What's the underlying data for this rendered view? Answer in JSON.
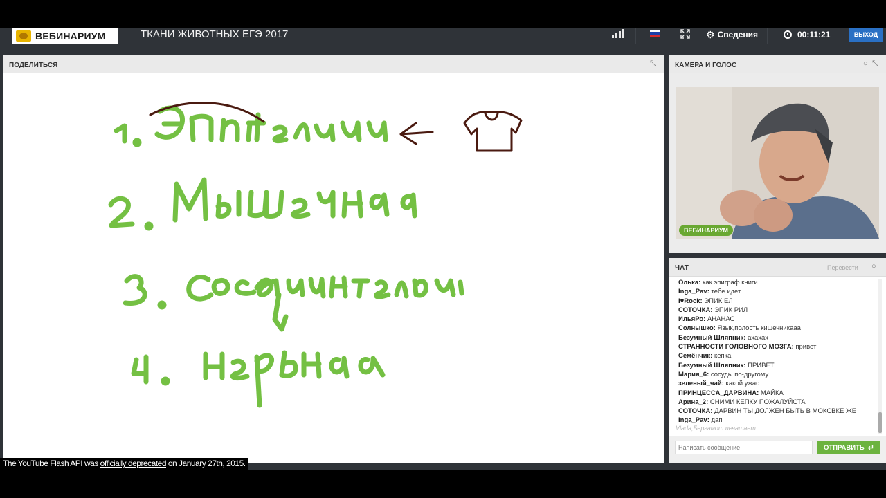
{
  "topbar": {
    "logo_text": "ВЕБИНАРИУМ",
    "course_title": "ТКАНИ ЖИВОТНЫХ  ЕГЭ 2017",
    "info_label": "Сведения",
    "timer": "00:11:21",
    "exit_label": "ВЫХОД",
    "flag_colors": [
      "#ffffff",
      "#1c3fa8",
      "#d62b2b"
    ]
  },
  "share_panel": {
    "title": "ПОДЕЛИТЬСЯ",
    "whiteboard": {
      "ink_green": "#74c043",
      "ink_brown": "#4a1a10"
    }
  },
  "camera_panel": {
    "title": "КАМЕРА И ГОЛОС",
    "badge": "ВЕБИНАРИУМ"
  },
  "chat": {
    "title": "ЧАТ",
    "translate_label": "Перевести",
    "messages": [
      {
        "user": "Олька:",
        "text": " как эпиграф книги"
      },
      {
        "user": "Inga_Pav:",
        "text": " тебе идет"
      },
      {
        "user": "I♥Rock:",
        "text": " ЭПИК ЕЛ"
      },
      {
        "user": "СОТОЧКА:",
        "text": " ЭПИК РИЛ"
      },
      {
        "user": "ИльяРо:",
        "text": " АНАНАС"
      },
      {
        "user": "Солнышко:",
        "text": " Язык,полость кишечникааа"
      },
      {
        "user": "Безумный Шляпник:",
        "text": " ахахах"
      },
      {
        "user": "СТРАННОСТИ ГОЛОВНОГО МОЗГА:",
        "text": " привет"
      },
      {
        "user": "Семёнчик:",
        "text": " кепка"
      },
      {
        "user": "Безумный Шляпник:",
        "text": " ПРИВЕТ"
      },
      {
        "user": "Мария_6:",
        "text": " сосуды по-другому"
      },
      {
        "user": "зеленый_чай:",
        "text": " какой ужас"
      },
      {
        "user": "ПРИНЦЕССА_ДАРВИНА:",
        "text": " МАЙКА"
      },
      {
        "user": "Арина_2:",
        "text": " СНИМИ КЕПКУ ПОЖАЛУЙСТА"
      },
      {
        "user": "СОТОЧКА:",
        "text": " ДАРВИН ТЫ ДОЛЖЕН БЫТЬ В МОКСВКЕ ЖЕ"
      },
      {
        "user": "Inga_Pav:",
        "text": " дап"
      }
    ],
    "typing": "Vlada,Бергамот печатает...",
    "input_placeholder": "Написать сообщение",
    "send_label": "ОТПРАВИТЬ"
  },
  "deprecation": {
    "prefix": "The YouTube Flash API was ",
    "link": "officially deprecated",
    "suffix": " on January 27th, 2015."
  }
}
